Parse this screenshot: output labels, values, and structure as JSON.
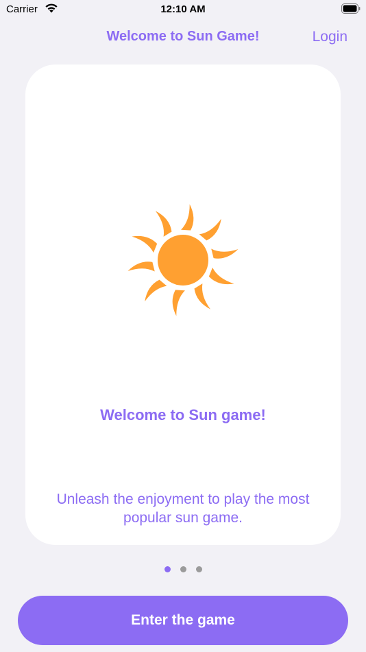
{
  "status_bar": {
    "carrier": "Carrier",
    "time": "12:10 AM"
  },
  "nav": {
    "title": "Welcome to Sun Game!",
    "login_label": "Login"
  },
  "card": {
    "icon": "sun-icon",
    "title": "Welcome to Sun game!",
    "subtitle": "Unleash the enjoyment to play the most popular sun game."
  },
  "pagination": {
    "count": 3,
    "active_index": 0
  },
  "actions": {
    "enter_label": "Enter the game"
  },
  "colors": {
    "accent": "#8c6cf3",
    "sun": "#ffa031",
    "background": "#f2f1f6",
    "card": "#ffffff"
  }
}
